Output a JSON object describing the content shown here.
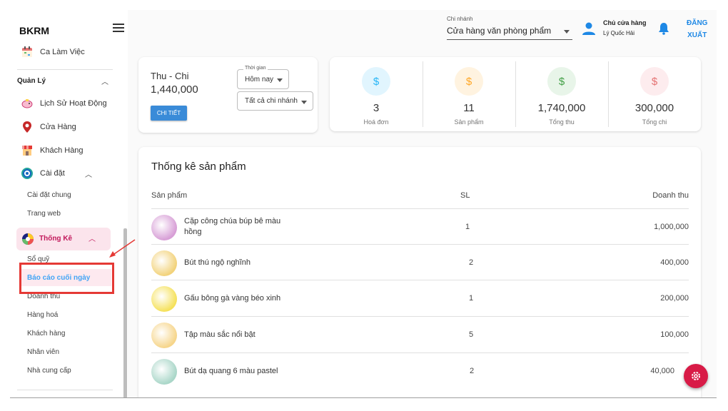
{
  "app": {
    "brand": "BKRM"
  },
  "header": {
    "branch_label": "Chi nhánh",
    "branch_value": "Cửa hàng văn phòng phẩm",
    "user_role": "Chủ cửa hàng",
    "user_name": "Lý Quốc Hải",
    "logout_line1": "ĐĂNG",
    "logout_line2": "XUẤT"
  },
  "sidebar": {
    "ca_lam_viec": "Ca Làm Việc",
    "quan_ly": "Quản Lý",
    "items": [
      {
        "label": "Lịch Sử Hoạt Động",
        "icon": "piggy-bank-icon"
      },
      {
        "label": "Cửa Hàng",
        "icon": "location-pin-icon"
      },
      {
        "label": "Khách Hàng",
        "icon": "shop-icon"
      },
      {
        "label": "Cài đặt",
        "icon": "settings-gear-icon"
      }
    ],
    "cai_dat_sub": [
      "Cài đặt chung",
      "Trang web"
    ],
    "thong_ke": "Thống Kê",
    "thong_ke_sub": [
      "Sổ quỹ",
      "Báo cáo cuối ngày",
      "Doanh thu",
      "Hàng hoá",
      "Khách hàng",
      "Nhân viên",
      "Nhà cung cấp"
    ],
    "active_sub": "Báo cáo cuối ngày"
  },
  "summary": {
    "title": "Thu - Chi",
    "value": "1,440,000",
    "detail_button": "CHI TIẾT",
    "time_label": "Thời gian",
    "time_value": "Hôm nay",
    "branch_filter": "Tất cả chi nhánh"
  },
  "stats": [
    {
      "value": "3",
      "caption": "Hoá đơn",
      "color": "#29b6f6",
      "bg": "#e1f5fe"
    },
    {
      "value": "11",
      "caption": "Sản phẩm",
      "color": "#ffa726",
      "bg": "#fff3e0"
    },
    {
      "value": "1,740,000",
      "caption": "Tổng thu",
      "color": "#43a047",
      "bg": "#e8f5e9"
    },
    {
      "value": "300,000",
      "caption": "Tổng chi",
      "color": "#e57373",
      "bg": "#fdecee"
    }
  ],
  "stat_symbol": "$",
  "products": {
    "title": "Thống kê sản phẩm",
    "headers": {
      "product": "Sản phẩm",
      "qty": "SL",
      "revenue": "Doanh thu"
    },
    "rows": [
      {
        "name": "Cặp công chúa búp bê màu hồng",
        "qty": "1",
        "revenue": "1,000,000",
        "thumb": "#d79ed6"
      },
      {
        "name": "Bút thú ngộ nghĩnh",
        "qty": "2",
        "revenue": "400,000",
        "thumb": "#f2d27a"
      },
      {
        "name": "Gấu bông gà vàng béo xinh",
        "qty": "1",
        "revenue": "200,000",
        "thumb": "#f5e15a"
      },
      {
        "name": "Tập màu sắc nổi bật",
        "qty": "5",
        "revenue": "100,000",
        "thumb": "#f6d58a"
      },
      {
        "name": "Bút dạ quang 6 màu pastel",
        "qty": "2",
        "revenue": "40,000",
        "thumb": "#a9d6c8"
      }
    ]
  }
}
